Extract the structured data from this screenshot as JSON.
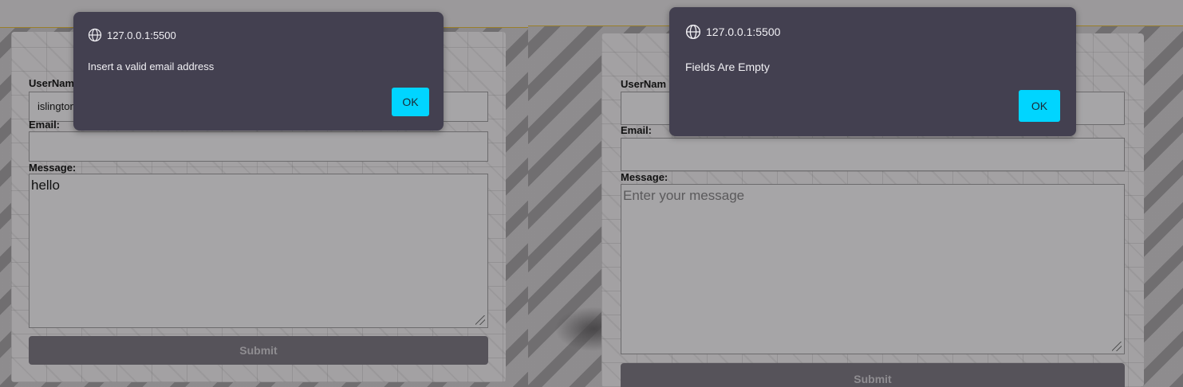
{
  "left": {
    "dialog": {
      "origin": "127.0.0.1:5500",
      "message": "Insert a valid email address",
      "ok_label": "OK"
    },
    "form": {
      "username_label": "UserName",
      "username_value": "islington",
      "email_label": "Email:",
      "email_value": "",
      "message_label": "Message:",
      "message_value": "hello",
      "submit_label": "Submit"
    }
  },
  "right": {
    "dialog": {
      "origin": "127.0.0.1:5500",
      "message": "Fields Are Empty",
      "ok_label": "OK"
    },
    "form": {
      "username_label": "UserNam",
      "username_value": "",
      "email_label": "Email:",
      "email_value": "",
      "message_label": "Message:",
      "message_placeholder": "Enter your message",
      "submit_label": "Submit"
    }
  },
  "colors": {
    "ok_button": "#00d5ff",
    "dialog_bg": "#434050",
    "submit_bg": "#56535a",
    "accent_line": "#9a7f2a"
  },
  "icons": [
    "globe-icon",
    "resize-grip-icon"
  ]
}
